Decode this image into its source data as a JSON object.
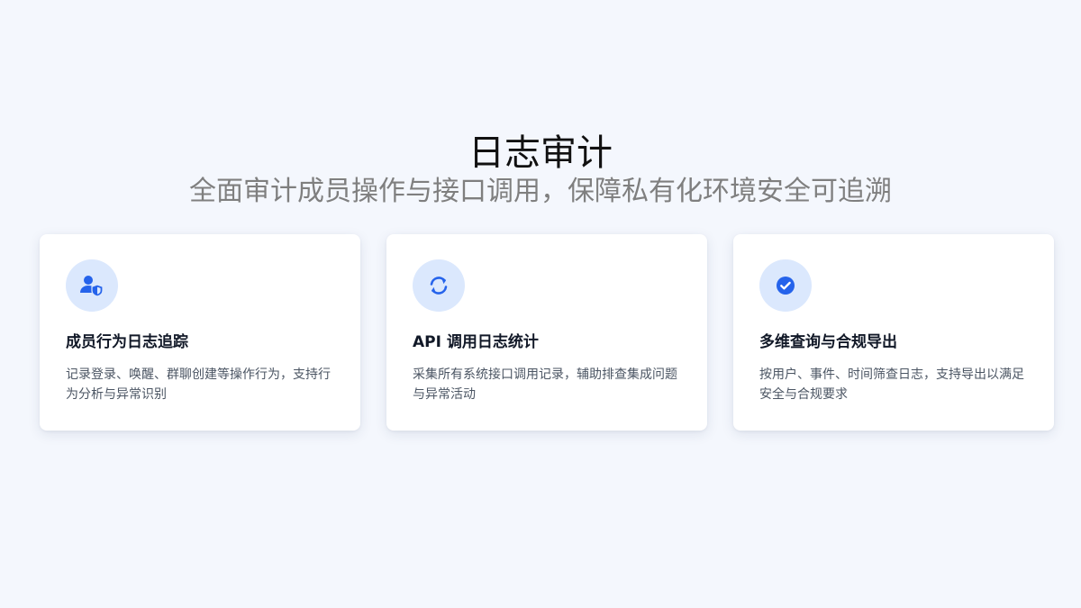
{
  "header": {
    "title": "日志审计",
    "subtitle": "全面审计成员操作与接口调用，保障私有化环境安全可追溯"
  },
  "colors": {
    "accent": "#2563eb",
    "icon_bg": "#dbe8fd",
    "background": "#f4f7fd"
  },
  "cards": [
    {
      "icon": "user-shield-icon",
      "title": "成员行为日志追踪",
      "description": "记录登录、唤醒、群聊创建等操作行为，支持行为分析与异常识别"
    },
    {
      "icon": "refresh-icon",
      "title": "API 调用日志统计",
      "description": "采集所有系统接口调用记录，辅助排查集成问题与异常活动"
    },
    {
      "icon": "check-circle-icon",
      "title": "多维查询与合规导出",
      "description": "按用户、事件、时间筛查日志，支持导出以满足安全与合规要求"
    }
  ]
}
